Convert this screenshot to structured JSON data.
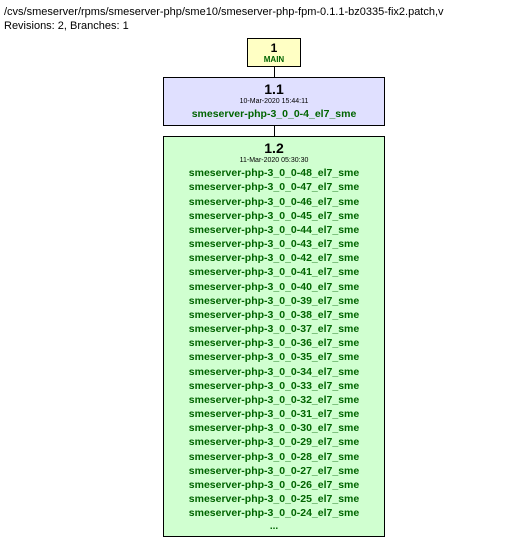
{
  "header": {
    "path": "/cvs/smeserver/rpms/smeserver-php/sme10/smeserver-php-fpm-0.1.1-bz0335-fix2.patch,v",
    "revisions": "Revisions: 2, Branches: 1"
  },
  "main_node": {
    "number": "1",
    "label": "MAIN"
  },
  "rev1": {
    "version": "1.1",
    "date": "10-Mar-2020 15:44:11",
    "tags": [
      "smeserver-php-3_0_0-4_el7_sme"
    ]
  },
  "rev2": {
    "version": "1.2",
    "date": "11-Mar-2020 05:30:30",
    "tags": [
      "smeserver-php-3_0_0-48_el7_sme",
      "smeserver-php-3_0_0-47_el7_sme",
      "smeserver-php-3_0_0-46_el7_sme",
      "smeserver-php-3_0_0-45_el7_sme",
      "smeserver-php-3_0_0-44_el7_sme",
      "smeserver-php-3_0_0-43_el7_sme",
      "smeserver-php-3_0_0-42_el7_sme",
      "smeserver-php-3_0_0-41_el7_sme",
      "smeserver-php-3_0_0-40_el7_sme",
      "smeserver-php-3_0_0-39_el7_sme",
      "smeserver-php-3_0_0-38_el7_sme",
      "smeserver-php-3_0_0-37_el7_sme",
      "smeserver-php-3_0_0-36_el7_sme",
      "smeserver-php-3_0_0-35_el7_sme",
      "smeserver-php-3_0_0-34_el7_sme",
      "smeserver-php-3_0_0-33_el7_sme",
      "smeserver-php-3_0_0-32_el7_sme",
      "smeserver-php-3_0_0-31_el7_sme",
      "smeserver-php-3_0_0-30_el7_sme",
      "smeserver-php-3_0_0-29_el7_sme",
      "smeserver-php-3_0_0-28_el7_sme",
      "smeserver-php-3_0_0-27_el7_sme",
      "smeserver-php-3_0_0-26_el7_sme",
      "smeserver-php-3_0_0-25_el7_sme",
      "smeserver-php-3_0_0-24_el7_sme"
    ],
    "ellipsis": "..."
  }
}
